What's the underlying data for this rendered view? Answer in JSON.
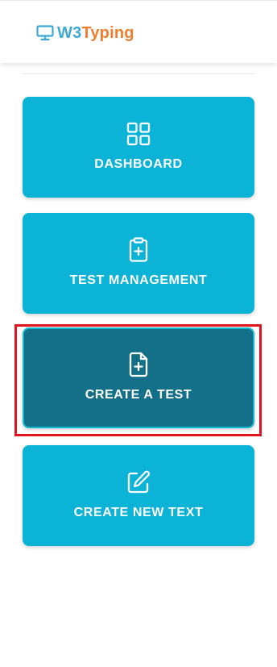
{
  "header": {
    "logo": {
      "icon": "monitor-icon",
      "brand_part1": "W3",
      "brand_part2": "Typing",
      "colors": {
        "part1": "#3fa9d6",
        "part2": "#f07d2e"
      }
    }
  },
  "menu": {
    "items": [
      {
        "label": "DASHBOARD",
        "icon": "grid-icon",
        "active": false
      },
      {
        "label": "TEST MANAGEMENT",
        "icon": "clipboard-plus-icon",
        "active": false
      },
      {
        "label": "CREATE A TEST",
        "icon": "file-plus-icon",
        "active": true
      },
      {
        "label": "CREATE NEW TEXT",
        "icon": "edit-icon",
        "active": false
      }
    ],
    "colors": {
      "tile": "#0bb3d6",
      "active_tile": "#137088",
      "highlight": "#e0141e"
    }
  }
}
